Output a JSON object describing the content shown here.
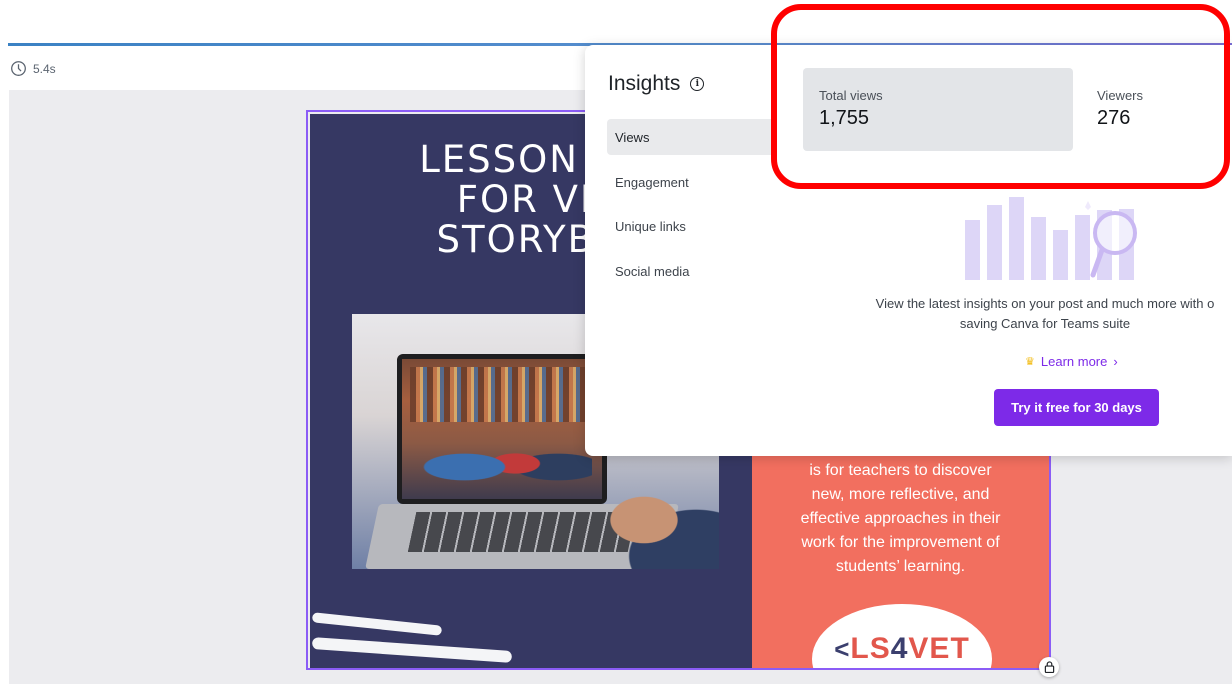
{
  "timer": {
    "duration": "5.4s"
  },
  "design": {
    "title": "LESSON ST\nFOR VE\nSTORYBO",
    "body_text": "is for teachers to discover\nnew, more reflective, and\neffective approaches in their\nwork for the improvement of\nstudents’ learning.",
    "logo": {
      "prefix": "LS",
      "number": "4",
      "suffix": "VET"
    }
  },
  "insights": {
    "title": "Insights",
    "nav": [
      {
        "label": "Views",
        "active": true
      },
      {
        "label": "Engagement",
        "active": false
      },
      {
        "label": "Unique links",
        "active": false
      },
      {
        "label": "Social media",
        "active": false
      }
    ],
    "stats": {
      "total_views_label": "Total views",
      "total_views_value": "1,755",
      "viewers_label": "Viewers",
      "viewers_value": "276"
    },
    "promo_text": "View the latest insights on your post and much more with o\nsaving Canva for Teams suite",
    "learn_more": "Learn more",
    "cta": "Try it free for 30 days"
  },
  "colors": {
    "accent": "#7d2ae8",
    "highlight": "#ff0000",
    "design_navy": "#363863",
    "design_salmon": "#f26f5f"
  }
}
